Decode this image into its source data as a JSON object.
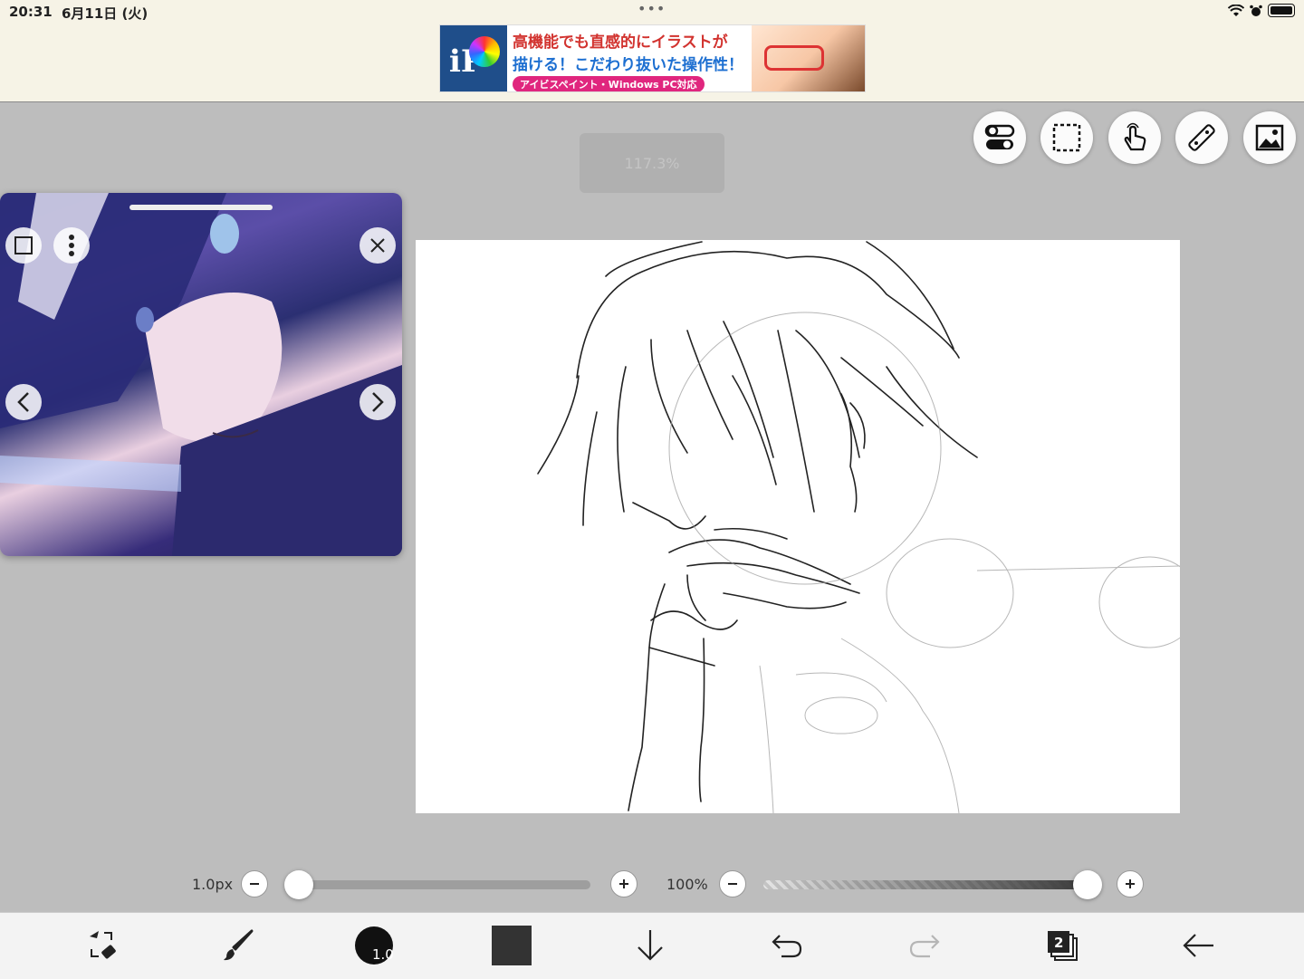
{
  "status_bar": {
    "time": "20:31",
    "date": "6月11日 (火)",
    "more_dots": "•••"
  },
  "ad": {
    "logo_letter": "iP",
    "line1": "高機能でも直感的にイラストが",
    "line2": "描ける！こだわり抜いた操作性！",
    "line3": "アイビスペイント・Windows PC対応"
  },
  "canvas": {
    "zoom_label": "117.3%"
  },
  "top_tools": [
    "toggle-icon",
    "selection-icon",
    "gesture-icon",
    "ruler-icon",
    "image-icon"
  ],
  "reference_panel": {
    "nav_prev": "<",
    "nav_next": ">"
  },
  "brush_size": {
    "label": "1.0px",
    "value_fraction": 0.0
  },
  "opacity": {
    "label": "100%",
    "value_fraction": 1.0
  },
  "toolbar": {
    "brush_size_badge": "1.0",
    "layer_count": "2"
  },
  "colors": {
    "current_color": "#333333",
    "background": "#bdbdbd"
  }
}
